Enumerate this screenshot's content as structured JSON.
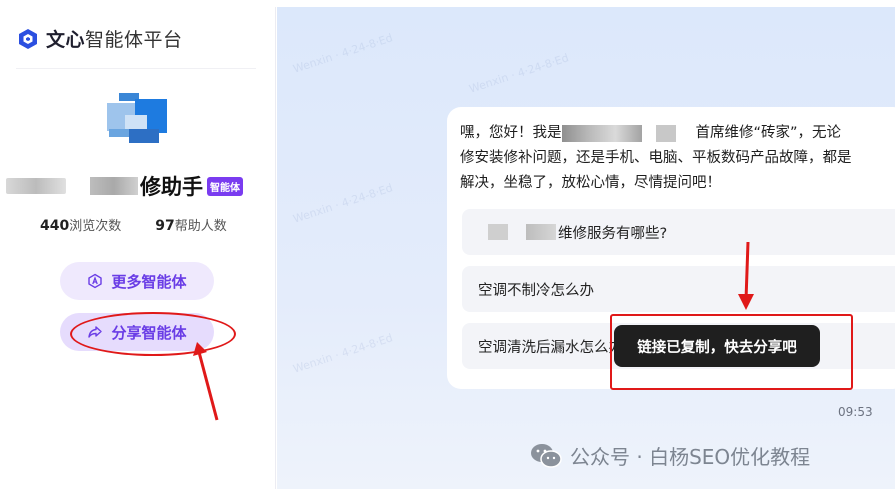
{
  "brand": {
    "name_bold": "文心",
    "name_light": "智能体平台"
  },
  "agent": {
    "name_suffix": "修助手",
    "badge": "智能体",
    "stats": {
      "views_value": "440",
      "views_label": "浏览次数",
      "helped_value": "97",
      "helped_label": "帮助人数"
    }
  },
  "sidebar": {
    "more_label": "更多智能体",
    "share_label": "分享智能体"
  },
  "chat": {
    "greeting_prefix": "嘿，您好！我是",
    "greeting_mid": "首席维修“砖家”，无论",
    "greeting_line2": "修安装修补问题，还是手机、电脑、平板数码产品故障，都是",
    "greeting_line3": "解决，坐稳了，放松心情，尽情提问吧！",
    "suggestions": [
      "维修服务有哪些?",
      "空调不制冷怎么办",
      "空调清洗后漏水怎么办"
    ],
    "time": "09:53"
  },
  "toast": {
    "message": "链接已复制，快去分享吧"
  },
  "watermark": {
    "text": "公众号 · 白杨SEO优化教程"
  },
  "colors": {
    "accent": "#6a3de6",
    "badge": "#7a3cf0",
    "annotation_red": "#e01919",
    "toast_bg": "#1f1f1f"
  }
}
